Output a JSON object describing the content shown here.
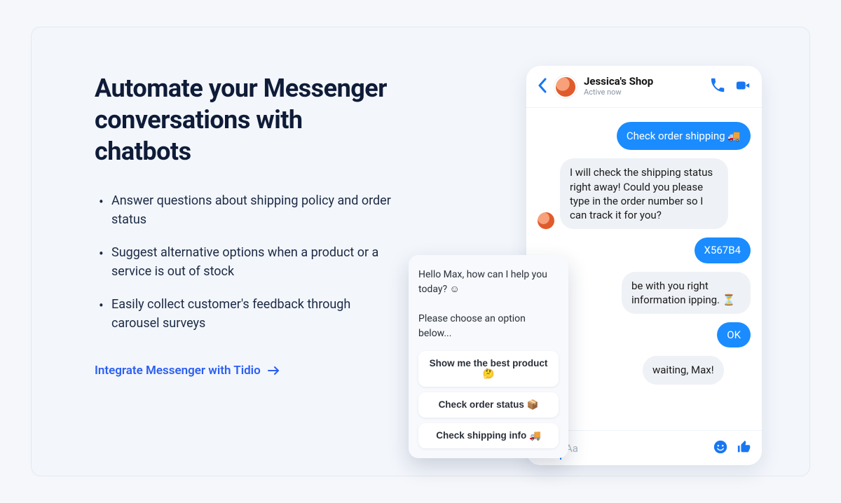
{
  "headline": "Automate your Messenger conversations with chatbots",
  "bullets": [
    "Answer questions about shipping policy and order status",
    "Suggest alternative options when a product or a service is out of stock",
    "Easily collect customer's feedback through carousel surveys"
  ],
  "cta_label": "Integrate Messenger with Tidio",
  "chat": {
    "shop_name": "Jessica's Shop",
    "status": "Active now",
    "messages": {
      "user1": "Check order shipping 🚚",
      "bot1": "I will check the shipping status right away! Could you please type in the order number so I can track it for you?",
      "user2": "X567B4",
      "bot2": "be with you right information ipping. ⏳",
      "user3": "OK",
      "bot3": "waiting, Max!"
    },
    "input_placeholder": "Aa"
  },
  "bot_card": {
    "line1": "Hello Max, how can I help you today? ☺",
    "line2": "Please choose an option below...",
    "options": [
      "Show me the best product 🤔",
      "Check order status 📦",
      "Check shipping info 🚚"
    ]
  }
}
